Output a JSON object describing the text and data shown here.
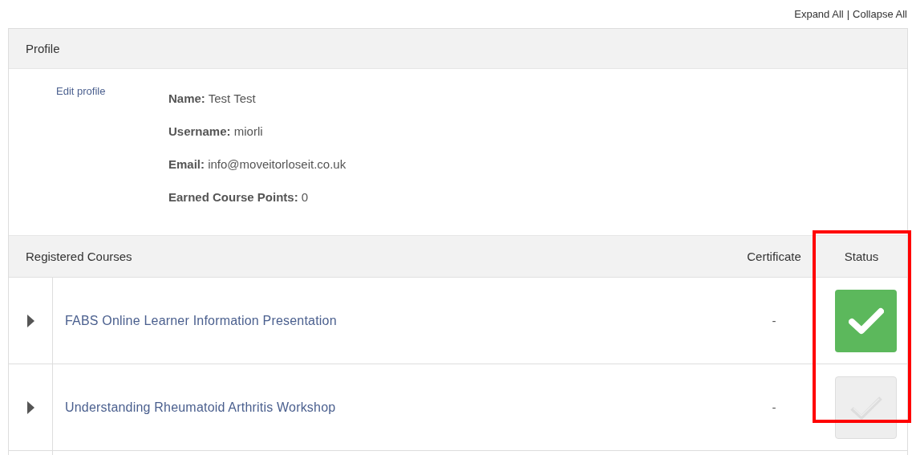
{
  "toolbar": {
    "links": [
      "Expand All",
      "Collapse All"
    ],
    "separator": "|"
  },
  "profile": {
    "title": "Profile",
    "edit_link": "Edit profile",
    "fields": [
      {
        "label": "Name:",
        "value": "Test Test"
      },
      {
        "label": "Username:",
        "value": "miorli"
      },
      {
        "label": "Email:",
        "value": "info@moveitorloseit.co.uk"
      },
      {
        "label": "Earned Course Points:",
        "value": "0"
      }
    ]
  },
  "courses": {
    "columns": [
      "Registered Courses",
      "Certificate",
      "Status"
    ],
    "rows": [
      {
        "title": "FABS Online Learner Information Presentation",
        "certificate": "-",
        "completed": true
      },
      {
        "title": "Understanding Rheumatoid Arthritis Workshop",
        "certificate": "-",
        "completed": false
      }
    ]
  },
  "annotation": {
    "kind": "frame"
  }
}
